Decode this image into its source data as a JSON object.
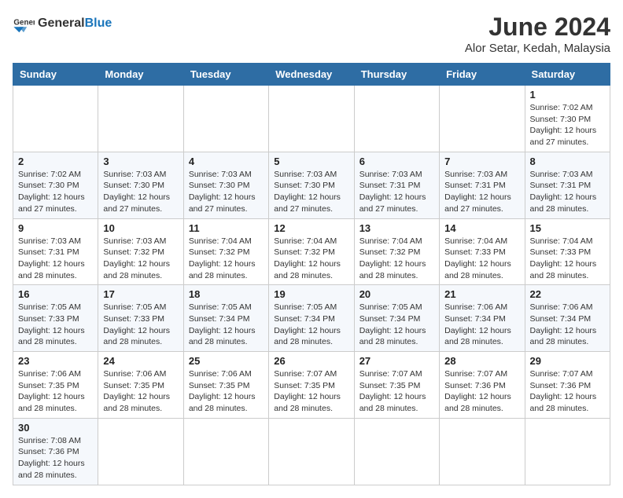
{
  "header": {
    "logo_general": "General",
    "logo_blue": "Blue",
    "month_year": "June 2024",
    "location": "Alor Setar, Kedah, Malaysia"
  },
  "weekdays": [
    "Sunday",
    "Monday",
    "Tuesday",
    "Wednesday",
    "Thursday",
    "Friday",
    "Saturday"
  ],
  "weeks": [
    [
      {
        "day": "",
        "info": ""
      },
      {
        "day": "",
        "info": ""
      },
      {
        "day": "",
        "info": ""
      },
      {
        "day": "",
        "info": ""
      },
      {
        "day": "",
        "info": ""
      },
      {
        "day": "",
        "info": ""
      },
      {
        "day": "1",
        "info": "Sunrise: 7:02 AM\nSunset: 7:30 PM\nDaylight: 12 hours and 27 minutes."
      }
    ],
    [
      {
        "day": "2",
        "info": "Sunrise: 7:02 AM\nSunset: 7:30 PM\nDaylight: 12 hours and 27 minutes."
      },
      {
        "day": "3",
        "info": "Sunrise: 7:03 AM\nSunset: 7:30 PM\nDaylight: 12 hours and 27 minutes."
      },
      {
        "day": "4",
        "info": "Sunrise: 7:03 AM\nSunset: 7:30 PM\nDaylight: 12 hours and 27 minutes."
      },
      {
        "day": "5",
        "info": "Sunrise: 7:03 AM\nSunset: 7:30 PM\nDaylight: 12 hours and 27 minutes."
      },
      {
        "day": "6",
        "info": "Sunrise: 7:03 AM\nSunset: 7:31 PM\nDaylight: 12 hours and 27 minutes."
      },
      {
        "day": "7",
        "info": "Sunrise: 7:03 AM\nSunset: 7:31 PM\nDaylight: 12 hours and 27 minutes."
      },
      {
        "day": "8",
        "info": "Sunrise: 7:03 AM\nSunset: 7:31 PM\nDaylight: 12 hours and 28 minutes."
      }
    ],
    [
      {
        "day": "9",
        "info": "Sunrise: 7:03 AM\nSunset: 7:31 PM\nDaylight: 12 hours and 28 minutes."
      },
      {
        "day": "10",
        "info": "Sunrise: 7:03 AM\nSunset: 7:32 PM\nDaylight: 12 hours and 28 minutes."
      },
      {
        "day": "11",
        "info": "Sunrise: 7:04 AM\nSunset: 7:32 PM\nDaylight: 12 hours and 28 minutes."
      },
      {
        "day": "12",
        "info": "Sunrise: 7:04 AM\nSunset: 7:32 PM\nDaylight: 12 hours and 28 minutes."
      },
      {
        "day": "13",
        "info": "Sunrise: 7:04 AM\nSunset: 7:32 PM\nDaylight: 12 hours and 28 minutes."
      },
      {
        "day": "14",
        "info": "Sunrise: 7:04 AM\nSunset: 7:33 PM\nDaylight: 12 hours and 28 minutes."
      },
      {
        "day": "15",
        "info": "Sunrise: 7:04 AM\nSunset: 7:33 PM\nDaylight: 12 hours and 28 minutes."
      }
    ],
    [
      {
        "day": "16",
        "info": "Sunrise: 7:05 AM\nSunset: 7:33 PM\nDaylight: 12 hours and 28 minutes."
      },
      {
        "day": "17",
        "info": "Sunrise: 7:05 AM\nSunset: 7:33 PM\nDaylight: 12 hours and 28 minutes."
      },
      {
        "day": "18",
        "info": "Sunrise: 7:05 AM\nSunset: 7:34 PM\nDaylight: 12 hours and 28 minutes."
      },
      {
        "day": "19",
        "info": "Sunrise: 7:05 AM\nSunset: 7:34 PM\nDaylight: 12 hours and 28 minutes."
      },
      {
        "day": "20",
        "info": "Sunrise: 7:05 AM\nSunset: 7:34 PM\nDaylight: 12 hours and 28 minutes."
      },
      {
        "day": "21",
        "info": "Sunrise: 7:06 AM\nSunset: 7:34 PM\nDaylight: 12 hours and 28 minutes."
      },
      {
        "day": "22",
        "info": "Sunrise: 7:06 AM\nSunset: 7:34 PM\nDaylight: 12 hours and 28 minutes."
      }
    ],
    [
      {
        "day": "23",
        "info": "Sunrise: 7:06 AM\nSunset: 7:35 PM\nDaylight: 12 hours and 28 minutes."
      },
      {
        "day": "24",
        "info": "Sunrise: 7:06 AM\nSunset: 7:35 PM\nDaylight: 12 hours and 28 minutes."
      },
      {
        "day": "25",
        "info": "Sunrise: 7:06 AM\nSunset: 7:35 PM\nDaylight: 12 hours and 28 minutes."
      },
      {
        "day": "26",
        "info": "Sunrise: 7:07 AM\nSunset: 7:35 PM\nDaylight: 12 hours and 28 minutes."
      },
      {
        "day": "27",
        "info": "Sunrise: 7:07 AM\nSunset: 7:35 PM\nDaylight: 12 hours and 28 minutes."
      },
      {
        "day": "28",
        "info": "Sunrise: 7:07 AM\nSunset: 7:36 PM\nDaylight: 12 hours and 28 minutes."
      },
      {
        "day": "29",
        "info": "Sunrise: 7:07 AM\nSunset: 7:36 PM\nDaylight: 12 hours and 28 minutes."
      }
    ],
    [
      {
        "day": "30",
        "info": "Sunrise: 7:08 AM\nSunset: 7:36 PM\nDaylight: 12 hours and 28 minutes."
      },
      {
        "day": "",
        "info": ""
      },
      {
        "day": "",
        "info": ""
      },
      {
        "day": "",
        "info": ""
      },
      {
        "day": "",
        "info": ""
      },
      {
        "day": "",
        "info": ""
      },
      {
        "day": "",
        "info": ""
      }
    ]
  ]
}
